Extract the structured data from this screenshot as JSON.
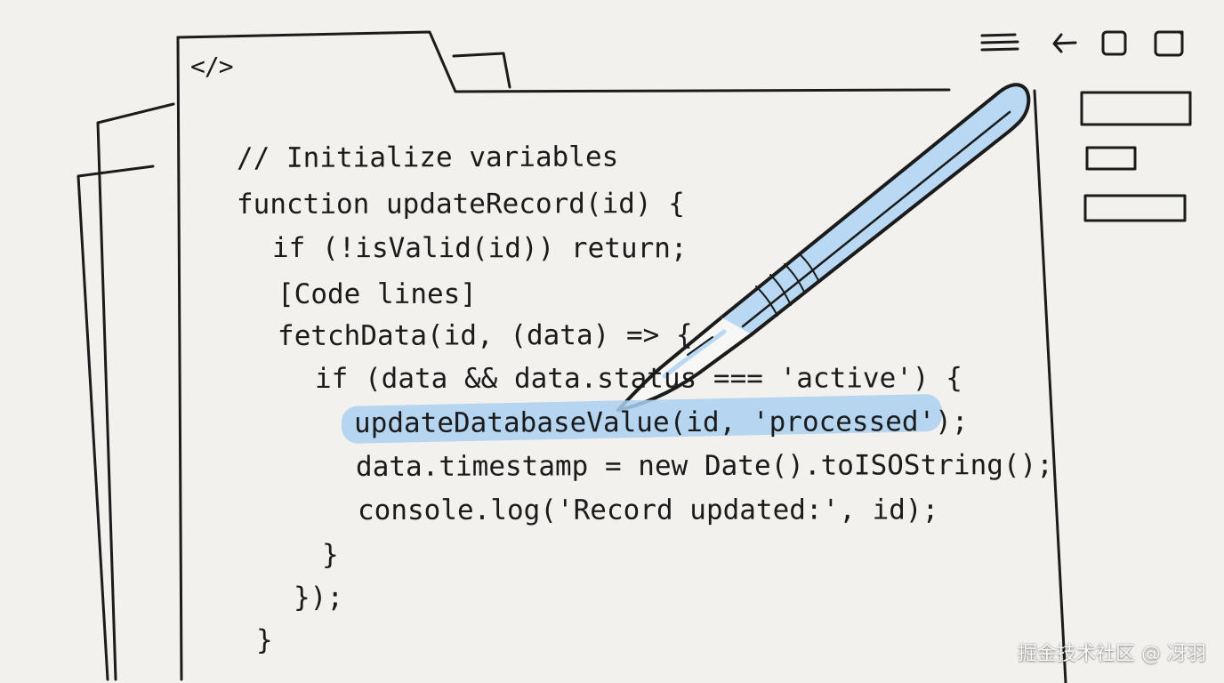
{
  "illustration": {
    "code_icon": "</>",
    "code_lines": [
      "// Initialize variables",
      "function updateRecord(id) {",
      "if (!isValid(id)) return;",
      "[Code lines]",
      "fetchData(id, (data) => {",
      "if (data && data.status === 'active') {",
      "updateDatabaseValue(id, 'processed');",
      "data.timestamp = new Date().toISOString();",
      "console.log('Record updated:', id);",
      "}",
      "});",
      "}"
    ],
    "watermark": "掘金技术社区 @ 冴羽"
  },
  "colors": {
    "background": "#f2f1ee",
    "ink": "#1b1b1b",
    "highlight": "#aad0f0",
    "scalpel": "#b8d8f4"
  },
  "icons": {
    "menu": "hamburger-menu-icon",
    "back": "left-arrow-icon",
    "square": "square-icon",
    "square_outline": "square-outline-icon",
    "scalpel": "scalpel-icon"
  }
}
